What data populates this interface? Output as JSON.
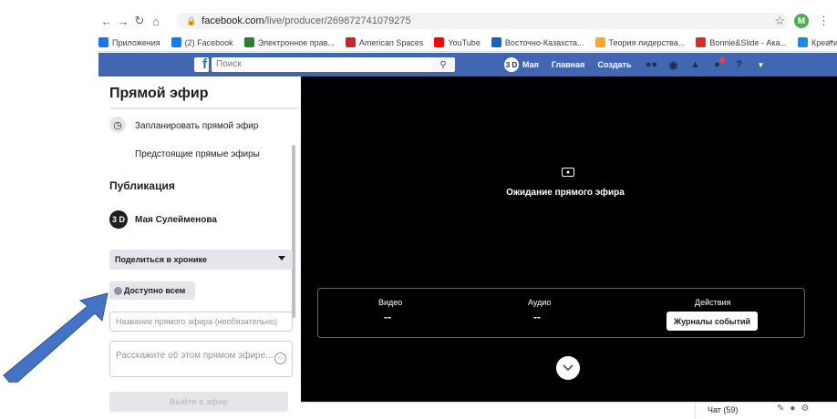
{
  "browser": {
    "url_host": "facebook.com",
    "url_path": "/live/producer/269872741079275",
    "profile_initial": "M",
    "bookmarks": [
      {
        "label": "Приложения",
        "icon": "apps-grid-icon",
        "color": "#1a73e8"
      },
      {
        "label": "(2) Facebook",
        "icon": "facebook-icon",
        "color": "#1877f2"
      },
      {
        "label": "Электронное прав...",
        "icon": "gov-icon",
        "color": "#2e7d32"
      },
      {
        "label": "American Spaces",
        "icon": "flag-icon",
        "color": "#c62828"
      },
      {
        "label": "YouTube",
        "icon": "youtube-icon",
        "color": "#ff0000"
      },
      {
        "label": "Восточно-Казахста...",
        "icon": "globe-icon",
        "color": "#1565c0"
      },
      {
        "label": "Теория лидерства...",
        "icon": "doc-icon",
        "color": "#f9a825"
      },
      {
        "label": "Bonnie&Slide - Ака...",
        "icon": "bs-icon",
        "color": "#d32f2f"
      },
      {
        "label": "Креативные форм...",
        "icon": "ring-icon",
        "color": "#1e88e5"
      }
    ]
  },
  "fb": {
    "search_placeholder": "Поиск",
    "avatar_text": "3 D",
    "user_short": "Мая",
    "home": "Главная",
    "create": "Создать"
  },
  "left": {
    "title": "Прямой эфир",
    "schedule": "Запланировать прямой эфир",
    "upcoming": "Предстоящие прямые эфиры",
    "publication": "Публикация",
    "user_avatar": "3 D",
    "user_name": "Мая Сулейменова",
    "share": "Поделиться в хронике",
    "audience": "Доступно всем",
    "title_placeholder": "Название прямого эфира (необязательно)",
    "desc_placeholder": "Расскажите об этом прямом эфире...",
    "go_live": "Выйти в эфир"
  },
  "stage": {
    "waiting": "Ожидание прямого эфира",
    "video_label": "Видео",
    "video_val": "--",
    "audio_label": "Аудио",
    "audio_val": "--",
    "actions_label": "Действия",
    "journal_button": "Журналы событий"
  },
  "chat": {
    "label": "Чат (59)"
  },
  "annotation": {
    "arrow_color": "#4472c4"
  }
}
